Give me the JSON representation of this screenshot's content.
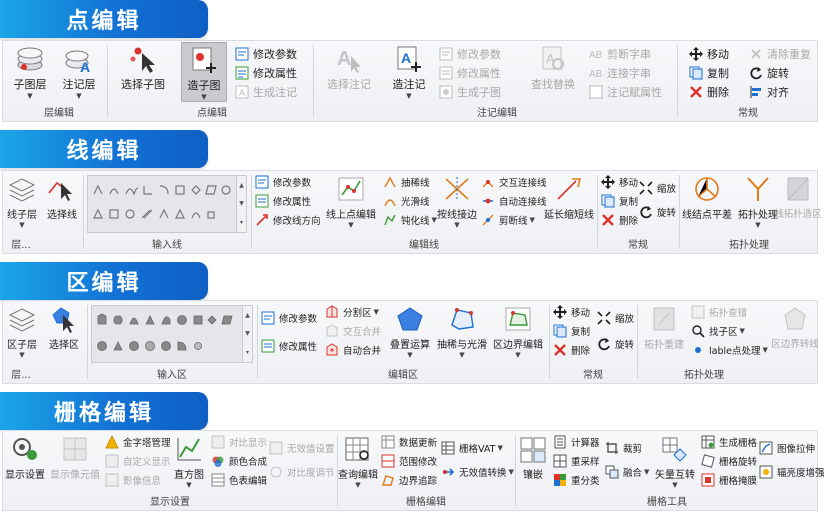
{
  "colors": {
    "header_start": "#1aa6e8",
    "header_end": "#0e5fc4",
    "accent_blue": "#1d6fd6",
    "accent_red": "#d9332b",
    "disabled": "#a8a8a8"
  },
  "point_edit": {
    "title": "点编辑",
    "layer_edit": {
      "label": "层编辑",
      "sub_layer": "子图层",
      "note_layer": "注记层"
    },
    "point_group": {
      "label": "点编辑",
      "select_sub": "选择子图",
      "make_sub": "造子图",
      "modify_param": "修改参数",
      "modify_attr": "修改属性",
      "gen_note": "生成注记"
    },
    "note_group": {
      "label": "注记编辑",
      "select_note": "选择注记",
      "make_note": "造注记",
      "modify_param": "修改参数",
      "modify_attr": "修改属性",
      "gen_sub": "生成子图",
      "find_replace": "查找替换",
      "cut_str": "剪断字串",
      "join_str": "连接字串",
      "note_attr": "注记赋属性"
    },
    "general": {
      "label": "常规",
      "move": "移动",
      "copy": "复制",
      "delete": "删除",
      "clear_dup": "清除重复",
      "rotate": "旋转",
      "align": "对齐"
    }
  },
  "line_edit": {
    "title": "线编辑",
    "layer": {
      "label": "层...",
      "line_layer": "线子层",
      "select_line": "选择线"
    },
    "input_line": {
      "label": "输入线"
    },
    "edit_line": {
      "label": "编辑线",
      "modify_param": "修改参数",
      "modify_attr": "修改属性",
      "modify_dir": "修改线方向",
      "on_line_edit": "线上点编辑",
      "thin": "抽稀线",
      "smooth": "光滑线",
      "simplify": "钝化线",
      "join": "按线接边",
      "interactive_join": "交互连接线",
      "auto_join": "自动连接线",
      "cut": "剪断线",
      "extend_short": "延长缩短线"
    },
    "general": {
      "label": "常规",
      "move": "移动",
      "copy": "复制",
      "delete": "删除",
      "scale": "缩放",
      "rotate": "旋转"
    },
    "topo": {
      "label": "拓扑处理",
      "node_balance": "线结点平差",
      "topo_process": "拓扑处理",
      "topo_make_area": "线拓扑造区"
    }
  },
  "area_edit": {
    "title": "区编辑",
    "layer": {
      "label": "层...",
      "area_layer": "区子层",
      "select_area": "选择区"
    },
    "input_area": {
      "label": "输入区"
    },
    "edit_area": {
      "label": "编辑区",
      "modify_param": "修改参数",
      "modify_attr": "修改属性",
      "split": "分割区",
      "interactive_merge": "交互合并",
      "auto_merge": "自动合并",
      "overlay": "叠置运算",
      "thin_smooth": "抽稀与光滑",
      "boundary_edit": "区边界编辑"
    },
    "general": {
      "label": "常规",
      "move": "移动",
      "copy": "复制",
      "delete": "删除",
      "scale": "缩放",
      "rotate": "旋转"
    },
    "topo": {
      "label": "拓扑处理",
      "topo_rebuild": "拓扑重建",
      "topo_check": "拓扑查错",
      "find_sub": "找子区",
      "lable_process": "lable点处理",
      "boundary_to_line": "区边界转线"
    }
  },
  "raster_edit": {
    "title": "栅格编辑",
    "display": {
      "label": "显示设置",
      "display_settings": "显示设置",
      "show_pixel": "显示像元值",
      "pyramid": "金字塔管理",
      "custom_display": "自定义显示",
      "image_info": "影像信息",
      "histogram": "直方图",
      "contrast_display": "对比显示",
      "color_synth": "颜色合成",
      "color_table": "色表编辑",
      "invalid_value": "无效值设置",
      "contrast_adjust": "对比度调节"
    },
    "raster_ops": {
      "label": "栅格编辑",
      "query_edit": "查询编辑",
      "data_update": "数据更新",
      "range_modify": "范围修改",
      "boundary_trace": "边界追踪",
      "raster_vat": "栅格VAT",
      "invalid_convert": "无效值转换"
    },
    "tools": {
      "label": "栅格工具",
      "mosaic": "镶嵌",
      "calculator": "计算器",
      "resample": "重采样",
      "reclassify": "重分类",
      "clip": "裁剪",
      "merge": "融合",
      "vector_convert": "矢量互转",
      "gen_raster": "生成栅格",
      "raster_rotate": "栅格旋转",
      "raster_mask": "栅格掩膜",
      "image_stretch": "图像拉伸",
      "brightness_contrast": "辐亮度增强"
    }
  }
}
